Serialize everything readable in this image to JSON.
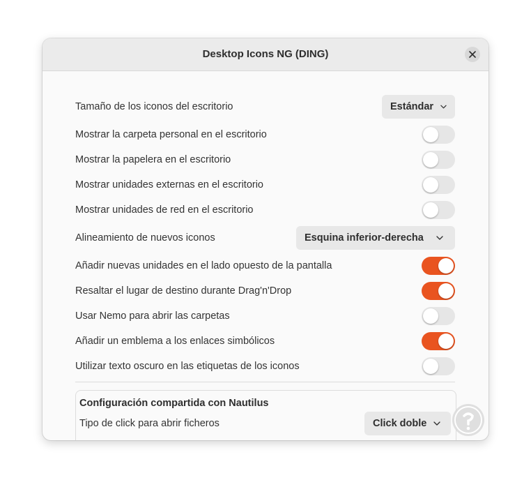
{
  "window": {
    "title": "Desktop Icons NG (DING)"
  },
  "settings": {
    "icon_size": {
      "label": "Tamaño de los iconos del escritorio",
      "value": "Estándar"
    },
    "show_home": {
      "label": "Mostrar la carpeta personal en el escritorio",
      "on": false
    },
    "show_trash": {
      "label": "Mostrar la papelera en el escritorio",
      "on": false
    },
    "show_external": {
      "label": "Mostrar unidades externas en el escritorio",
      "on": false
    },
    "show_network": {
      "label": "Mostrar unidades de red en el escritorio",
      "on": false
    },
    "alignment": {
      "label": "Alineamiento de nuevos iconos",
      "value": "Esquina inferior-derecha"
    },
    "add_opposite": {
      "label": "Añadir nuevas unidades en el lado opuesto de la pantalla",
      "on": true
    },
    "highlight_drop": {
      "label": "Resaltar el lugar de destino durante Drag'n'Drop",
      "on": true
    },
    "use_nemo": {
      "label": "Usar Nemo para abrir las carpetas",
      "on": false
    },
    "emblem_links": {
      "label": "Añadir un emblema a los enlaces simbólicos",
      "on": true
    },
    "dark_text": {
      "label": "Utilizar texto oscuro en las etiquetas de los iconos",
      "on": false
    }
  },
  "nautilus": {
    "title": "Configuración compartida con Nautilus",
    "click_type": {
      "label": "Tipo de click para abrir ficheros",
      "value": "Click doble"
    }
  },
  "colors": {
    "accent": "#e95420",
    "toggle_off": "#e6e6e6",
    "titlebar": "#ebebeb"
  }
}
